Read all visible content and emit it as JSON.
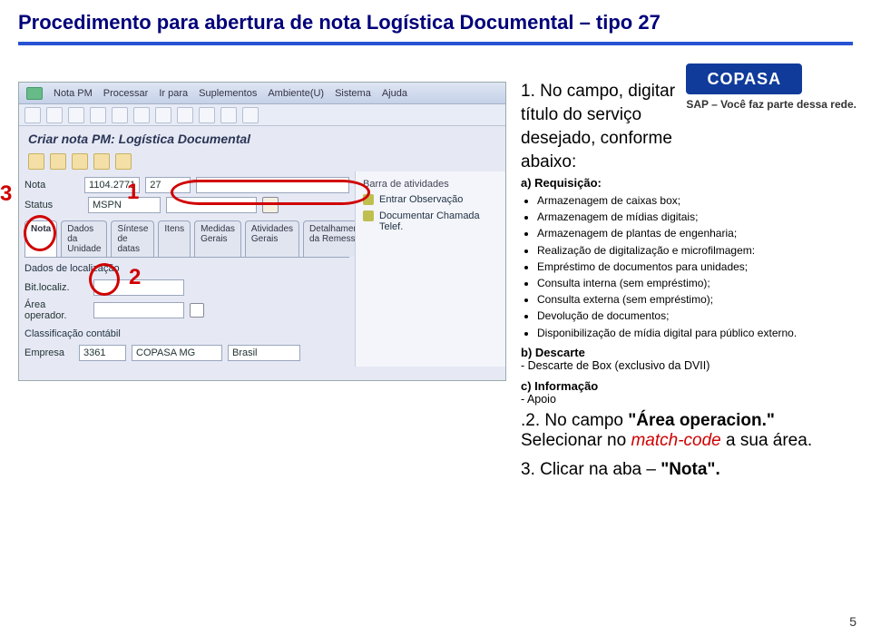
{
  "page": {
    "title": "Procedimento para abertura de nota  Logística Documental – tipo 27",
    "page_number": "5"
  },
  "logo": {
    "brand": "COPASA",
    "sap_line": "SAP – Você faz parte dessa rede."
  },
  "sap": {
    "menu": [
      "Nota PM",
      "Processar",
      "Ir para",
      "Suplementos",
      "Ambiente(U)",
      "Sistema",
      "Ajuda"
    ],
    "subtitle": "Criar nota PM: Logística Documental",
    "fields": {
      "nota_label": "Nota",
      "nota_value": "1104.2771",
      "tipo": "27",
      "titulo_value": "",
      "status_label": "Status",
      "status_value": "MSPN",
      "area_label": "Área operador.",
      "area_value": "",
      "beloc_label": "Bit.localiz.",
      "empresa_label": "Empresa",
      "empresa_cod": "3361",
      "empresa_nome": "COPASA MG",
      "pais": "Brasil",
      "classif_label": "Classificação contábil"
    },
    "tabs": [
      "Nota",
      "Dados da Unidade",
      "Síntese de datas",
      "Itens",
      "Medidas Gerais",
      "Atividades Gerais",
      "Detalhamento da Remessa"
    ],
    "section_dados": "Dados de localização",
    "side": {
      "title": "Barra de atividades",
      "items": [
        "Entrar Observação",
        "Documentar Chamada Telef."
      ]
    }
  },
  "anno": {
    "n1": "1",
    "n2": "2",
    "n3": "3"
  },
  "instructions": {
    "step1_line1": "1. No campo, digitar",
    "step1_line2": "título do serviço",
    "step1_line3": "desejado, conforme",
    "step1_line4": "abaixo:",
    "req_head": "a) Requisição:",
    "bullets": [
      "Armazenagem de caixas box;",
      "Armazenagem de mídias digitais;",
      "Armazenagem de plantas de engenharia;",
      "Realização de digitalização e microfilmagem:",
      "Empréstimo de documentos para unidades;",
      "Consulta interna (sem empréstimo);",
      "Consulta externa (sem empréstimo);",
      "Devolução de documentos;",
      "Disponibilização de mídia digital para público externo."
    ],
    "b_head": "b) Descarte",
    "b_line": " - Descarte de Box   (exclusivo da DVII)",
    "c_head": "c) Informação",
    "c_line": " - Apoio",
    "step2_num": ".2. ",
    "step2_a": "No campo ",
    "step2_b": "\"Área operacion.\"",
    "step2_c": " Selecionar no ",
    "step2_match": "match-code",
    "step2_d": " a sua área.",
    "step3": "3. Clicar na aba – ",
    "step3_tab": "\"Nota\"."
  }
}
